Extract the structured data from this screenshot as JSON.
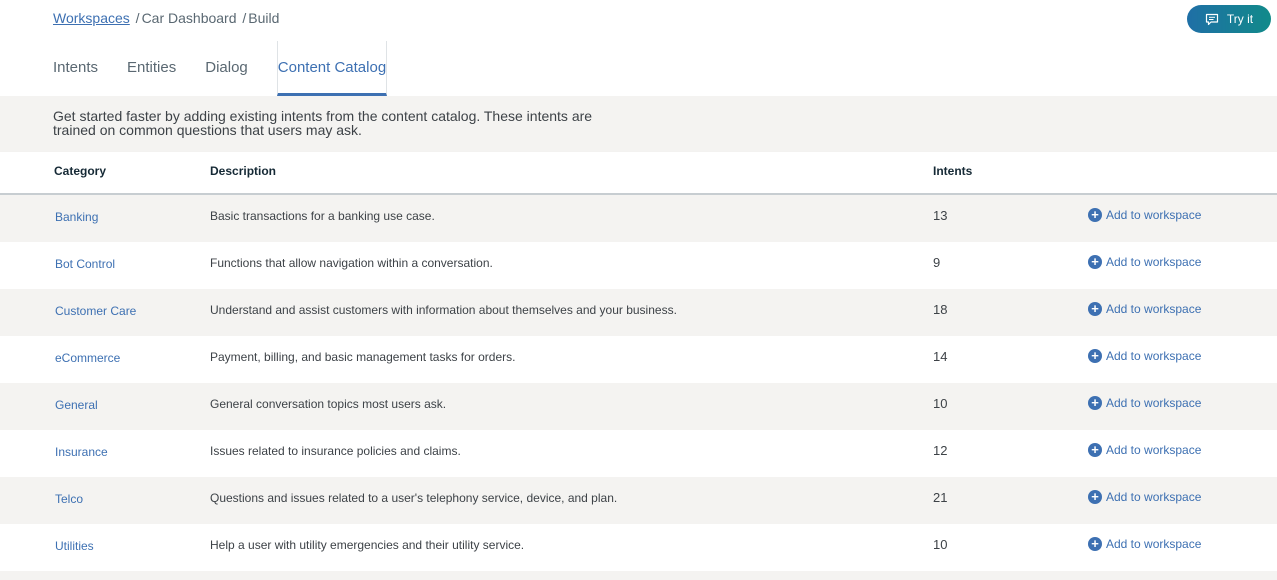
{
  "breadcrumb": {
    "workspaces": "Workspaces",
    "separator": "/",
    "workspace_name": "Car Dashboard",
    "section": "Build"
  },
  "try_button": {
    "label": "Try it",
    "icon": "chat-bubble-icon"
  },
  "tabs": [
    {
      "label": "Intents",
      "active": false
    },
    {
      "label": "Entities",
      "active": false
    },
    {
      "label": "Dialog",
      "active": false
    },
    {
      "label": "Content Catalog",
      "active": true
    }
  ],
  "intro_text": "Get started faster by adding existing intents from the content catalog. These intents are trained on common questions that users may ask.",
  "table": {
    "headers": {
      "category": "Category",
      "description": "Description",
      "intents": "Intents"
    },
    "action_label": "Add to workspace",
    "action_icon": "add-circle-icon",
    "rows": [
      {
        "category": "Banking",
        "description": "Basic transactions for a banking use case.",
        "intents": "13"
      },
      {
        "category": "Bot Control",
        "description": "Functions that allow navigation within a conversation.",
        "intents": "9"
      },
      {
        "category": "Customer Care",
        "description": "Understand and assist customers with information about themselves and your business.",
        "intents": "18"
      },
      {
        "category": "eCommerce",
        "description": "Payment, billing, and basic management tasks for orders.",
        "intents": "14"
      },
      {
        "category": "General",
        "description": "General conversation topics most users ask.",
        "intents": "10"
      },
      {
        "category": "Insurance",
        "description": "Issues related to insurance policies and claims.",
        "intents": "12"
      },
      {
        "category": "Telco",
        "description": "Questions and issues related to a user's telephony service, device, and plan.",
        "intents": "21"
      },
      {
        "category": "Utilities",
        "description": "Help a user with utility emergencies and their utility service.",
        "intents": "10"
      }
    ]
  },
  "colors": {
    "link": "#3d70b2",
    "stripe": "#f4f3f1",
    "try_gradient_start": "#1f6fa6",
    "try_gradient_end": "#118a8a"
  }
}
